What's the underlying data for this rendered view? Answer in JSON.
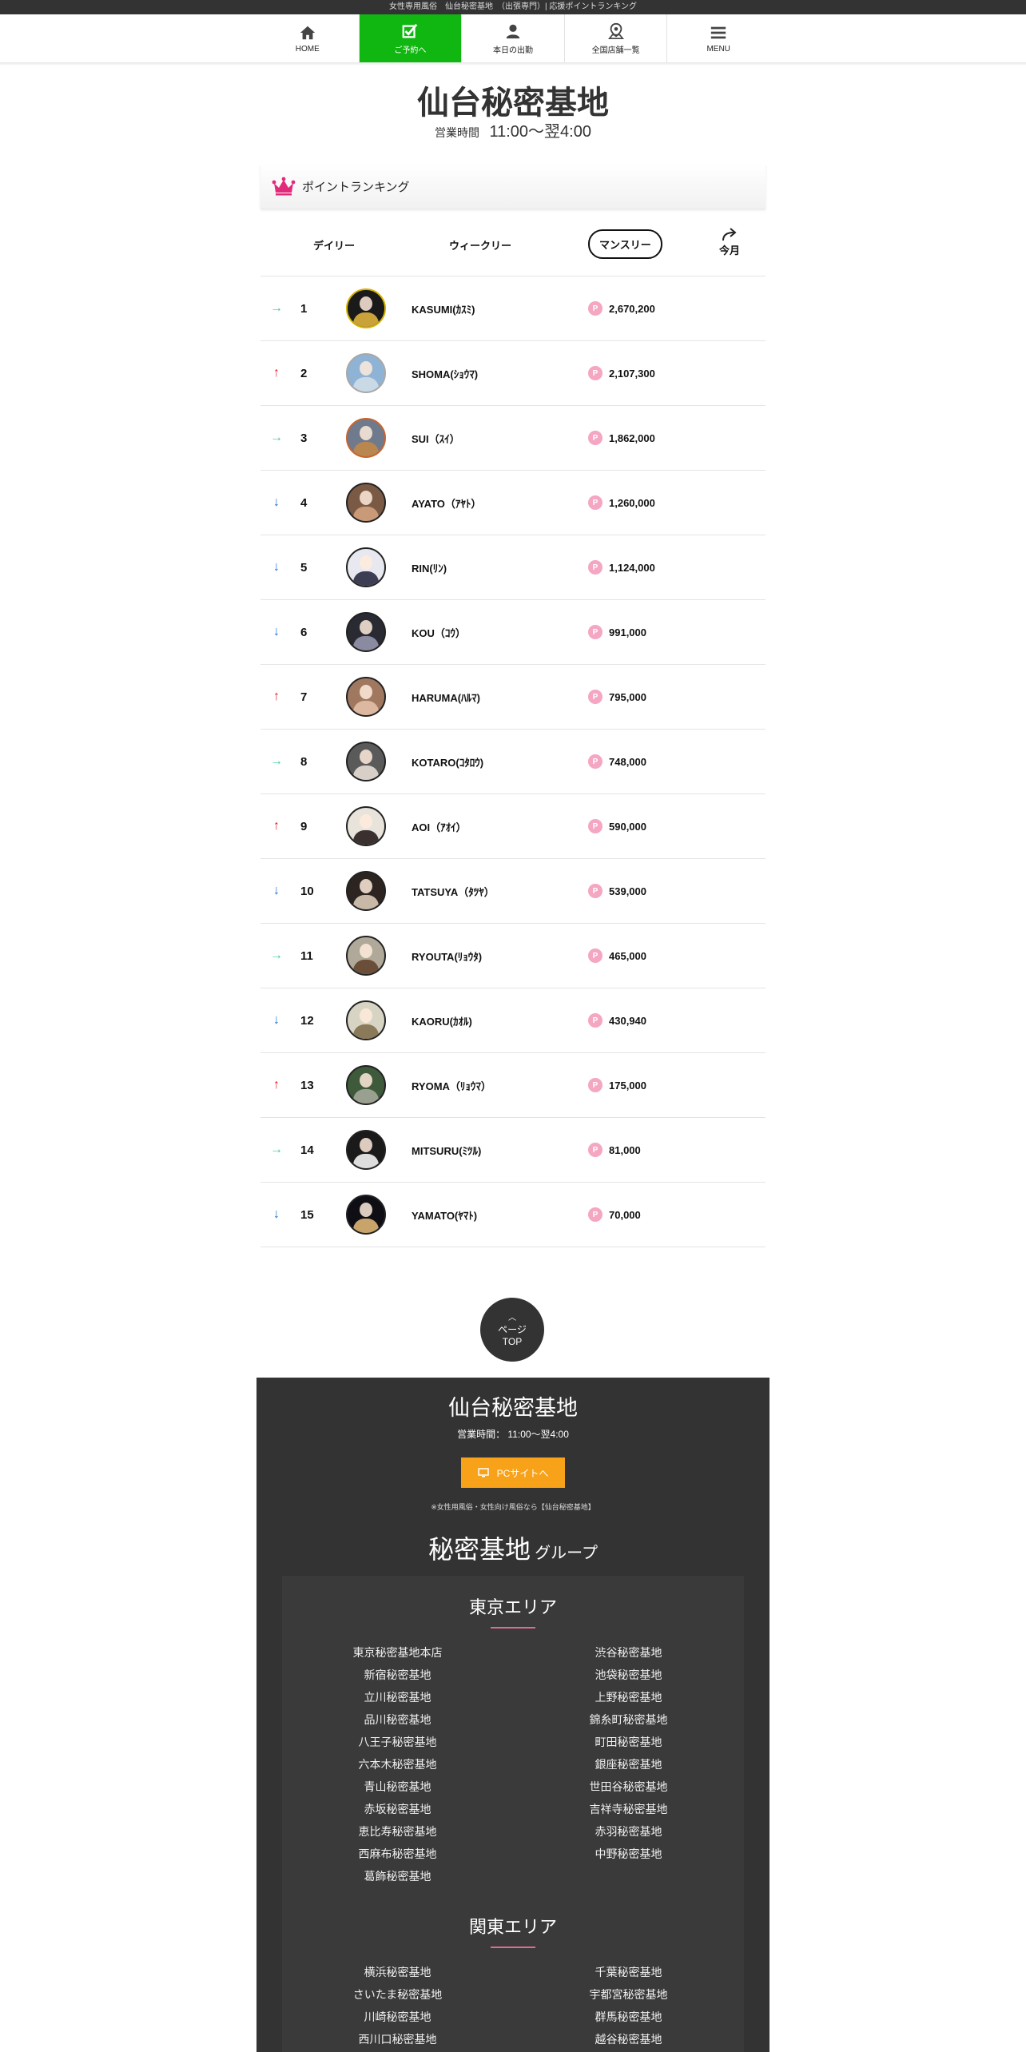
{
  "topbar": {
    "text": "女性専用風俗　仙台秘密基地　（出張専門）| 応援ポイントランキング"
  },
  "nav": [
    {
      "label": "HOME",
      "icon": "home-icon"
    },
    {
      "label": "ご予約へ",
      "icon": "check-icon"
    },
    {
      "label": "本日の出勤",
      "icon": "person-icon"
    },
    {
      "label": "全国店舗一覧",
      "icon": "map-pin-icon"
    },
    {
      "label": "MENU",
      "icon": "hamburger-icon"
    }
  ],
  "shop": {
    "title": "仙台秘密基地",
    "hours_label": "営業時間",
    "hours": "11:00〜翌4:00"
  },
  "ranking": {
    "header": "ポイントランキング",
    "tabs": {
      "daily": "デイリー",
      "weekly": "ウィークリー",
      "monthly": "マンスリー",
      "this_month": "今月"
    },
    "colors": {
      "up": "#e11d2a",
      "down": "#1d72d6",
      "same": "#3ccb9a",
      "point_badge": "#f4a6c2"
    },
    "rows": [
      {
        "trend": "same",
        "arrow": "→",
        "rank": "1",
        "name": "KASUMI(ｶｽﾐ)",
        "points": "2,670,200"
      },
      {
        "trend": "up",
        "arrow": "↑",
        "rank": "2",
        "name": "SHOMA(ｼｮｳﾏ)",
        "points": "2,107,300"
      },
      {
        "trend": "same",
        "arrow": "→",
        "rank": "3",
        "name": "SUI（ｽｲ）",
        "points": "1,862,000"
      },
      {
        "trend": "down",
        "arrow": "↓",
        "rank": "4",
        "name": "AYATO（ｱﾔﾄ）",
        "points": "1,260,000"
      },
      {
        "trend": "down",
        "arrow": "↓",
        "rank": "5",
        "name": "RIN(ﾘﾝ)",
        "points": "1,124,000"
      },
      {
        "trend": "down",
        "arrow": "↓",
        "rank": "6",
        "name": "KOU（ｺｳ）",
        "points": "991,000"
      },
      {
        "trend": "up",
        "arrow": "↑",
        "rank": "7",
        "name": "HARUMA(ﾊﾙﾏ)",
        "points": "795,000"
      },
      {
        "trend": "same",
        "arrow": "→",
        "rank": "8",
        "name": "KOTARO(ｺﾀﾛｳ)",
        "points": "748,000"
      },
      {
        "trend": "up",
        "arrow": "↑",
        "rank": "9",
        "name": "AOI（ｱｵｲ）",
        "points": "590,000"
      },
      {
        "trend": "down",
        "arrow": "↓",
        "rank": "10",
        "name": "TATSUYA（ﾀﾂﾔ）",
        "points": "539,000"
      },
      {
        "trend": "same",
        "arrow": "→",
        "rank": "11",
        "name": "RYOUTA(ﾘｮｳﾀ)",
        "points": "465,000"
      },
      {
        "trend": "down",
        "arrow": "↓",
        "rank": "12",
        "name": "KAORU(ｶｵﾙ)",
        "points": "430,940"
      },
      {
        "trend": "up",
        "arrow": "↑",
        "rank": "13",
        "name": "RYOMA（ﾘｮｳﾏ）",
        "points": "175,000"
      },
      {
        "trend": "same",
        "arrow": "→",
        "rank": "14",
        "name": "MITSURU(ﾐﾂﾙ)",
        "points": "81,000"
      },
      {
        "trend": "down",
        "arrow": "↓",
        "rank": "15",
        "name": "YAMATO(ﾔﾏﾄ)",
        "points": "70,000"
      }
    ]
  },
  "pagetop": {
    "line1": "ページ",
    "line2": "TOP"
  },
  "footer": {
    "title": "仙台秘密基地",
    "hours": "営業時間： 11:00〜翌4:00",
    "pc_button": "PCサイトへ",
    "note": "※女性用風俗・女性向け風俗なら【仙台秘密基地】",
    "group_big": "秘密基地",
    "group_small": "グループ",
    "areas": [
      {
        "title": "東京エリア",
        "shops": [
          "東京秘密基地本店",
          "渋谷秘密基地",
          "新宿秘密基地",
          "池袋秘密基地",
          "立川秘密基地",
          "上野秘密基地",
          "品川秘密基地",
          "錦糸町秘密基地",
          "八王子秘密基地",
          "町田秘密基地",
          "六本木秘密基地",
          "銀座秘密基地",
          "青山秘密基地",
          "世田谷秘密基地",
          "赤坂秘密基地",
          "吉祥寺秘密基地",
          "恵比寿秘密基地",
          "赤羽秘密基地",
          "西麻布秘密基地",
          "中野秘密基地",
          "葛飾秘密基地"
        ]
      },
      {
        "title": "関東エリア",
        "shops": [
          "横浜秘密基地",
          "千葉秘密基地",
          "さいたま秘密基地",
          "宇都宮秘密基地",
          "川崎秘密基地",
          "群馬秘密基地",
          "西川口秘密基地",
          "越谷秘密基地"
        ]
      }
    ]
  }
}
